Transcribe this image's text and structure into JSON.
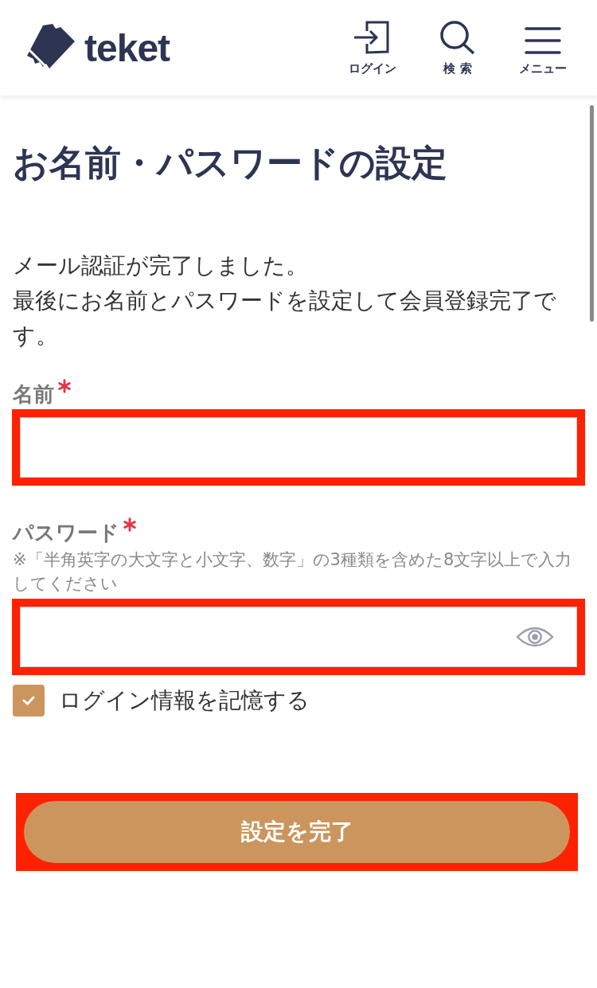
{
  "header": {
    "logo": "teket",
    "nav": [
      {
        "kind": "login",
        "label": "ログイン"
      },
      {
        "kind": "search",
        "label": "検 索"
      },
      {
        "kind": "menu",
        "label": "メニュー"
      }
    ]
  },
  "title": "お名前・パスワードの設定",
  "intro": [
    "メール認証が完了しました。",
    "最後にお名前とパスワードを設定して会員登録完了です。"
  ],
  "fields": [
    {
      "kind": "text",
      "label": "名前",
      "required": true,
      "highlighted": true
    },
    {
      "kind": "password",
      "label": "パスワード",
      "required": true,
      "hint": "※「半角英字の大文字と小文字、数字」の3種類を含めた8文字以上で入力してください",
      "highlighted": true
    }
  ],
  "remember": {
    "label": "ログイン情報を記憶する",
    "checked": true
  },
  "submit": {
    "label": "設定を完了",
    "highlighted": true
  }
}
